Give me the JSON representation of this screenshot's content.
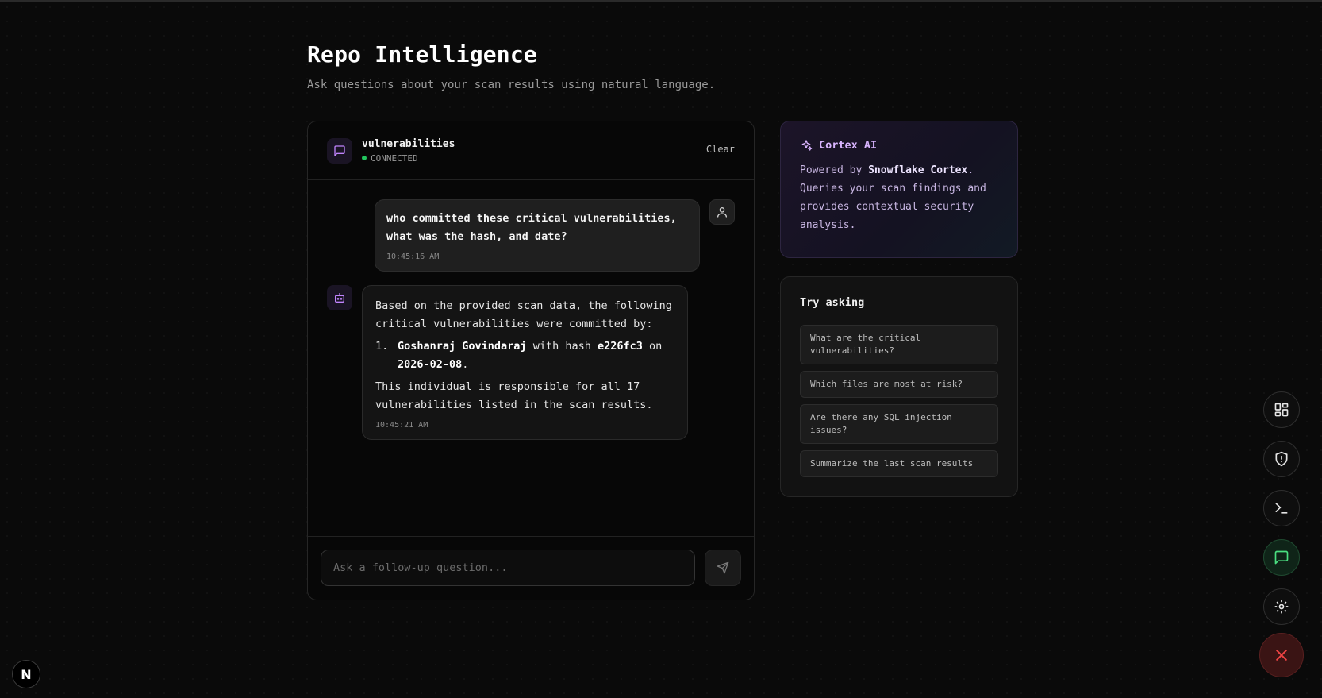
{
  "header": {
    "title": "Repo Intelligence",
    "subtitle": "Ask questions about your scan results using natural language."
  },
  "chat": {
    "title": "vulnerabilities",
    "status": "CONNECTED",
    "clear_label": "Clear",
    "messages": [
      {
        "role": "user",
        "text": "who committed these critical vulnerabilities, what was the hash, and date?",
        "time": "10:45:16 AM"
      },
      {
        "role": "assistant",
        "intro": "Based on the provided scan data, the following critical vulnerabilities were committed by:",
        "list_number": "1.",
        "author": "Goshanraj Govindaraj",
        "with_hash_text": "with hash",
        "hash": "e226fc3",
        "on_text": "on",
        "date": "2026-02-08",
        "period": ".",
        "outro": "This individual is responsible for all 17 vulnerabilities listed in the scan results.",
        "time": "10:45:21 AM"
      }
    ],
    "input_placeholder": "Ask a follow-up question..."
  },
  "cortex": {
    "title": "Cortex AI",
    "text_prefix": "Powered by",
    "brand": "Snowflake Cortex",
    "text_suffix": ". Queries your scan findings and provides contextual security analysis."
  },
  "suggestions": {
    "title": "Try asking",
    "items": [
      "What are the critical vulnerabilities?",
      "Which files are most at risk?",
      "Are there any SQL injection issues?",
      "Summarize the last scan results"
    ]
  },
  "side_nav": {
    "icons": [
      "dashboard-icon",
      "shield-icon",
      "terminal-icon",
      "chat-icon",
      "gear-icon"
    ],
    "active": "chat-icon",
    "close_icon": "close-icon"
  },
  "framework_badge": {
    "letter": "N"
  },
  "colors": {
    "background": "#0a0a0a",
    "accent_purple": "#d8b4fe",
    "status_green": "#22c55e",
    "close_red": "#ef4444"
  }
}
